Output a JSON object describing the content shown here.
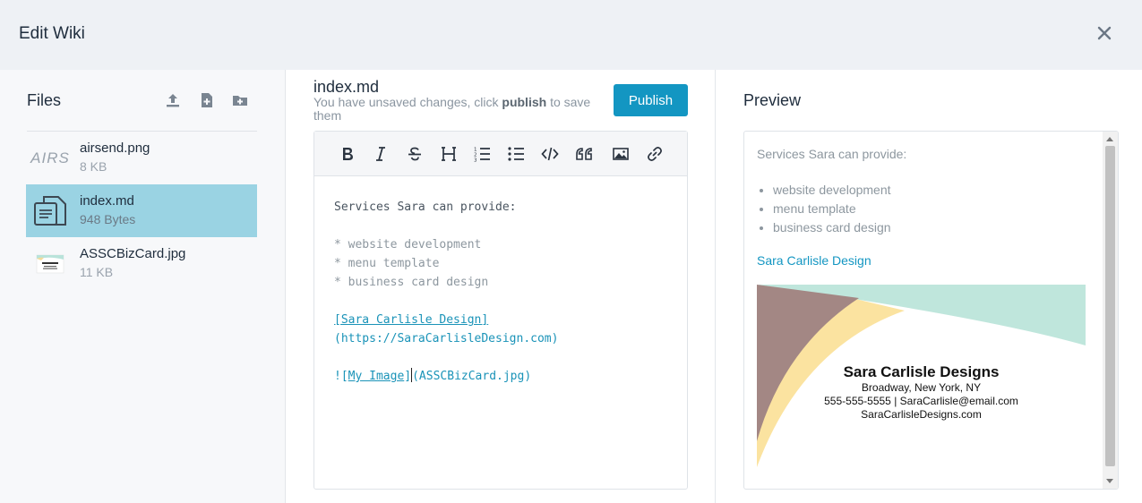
{
  "window": {
    "title": "Edit Wiki"
  },
  "files": {
    "heading": "Files",
    "items": [
      {
        "name": "airsend.png",
        "size": "8 KB",
        "thumb_text": "AIRS"
      },
      {
        "name": "index.md",
        "size": "948 Bytes",
        "active": true
      },
      {
        "name": "ASSCBizCard.jpg",
        "size": "11 KB"
      }
    ]
  },
  "editor": {
    "filename": "index.md",
    "notice_pre": "You have unsaved changes, click ",
    "notice_bold": "publish",
    "notice_post": " to save them",
    "publish_label": "Publish",
    "lines": {
      "l1": "Services Sara can provide:",
      "l2": "* website development",
      "l3": "* menu template",
      "l4": "* business card design",
      "l5_text": "[Sara Carlisle Design]",
      "l6": "(https://SaraCarlisleDesign.com)",
      "l7_prefix": "![",
      "l7_text": "My Image",
      "l7_close": "]",
      "l7_rest": "(ASSCBizCard.jpg)"
    }
  },
  "preview": {
    "heading": "Preview",
    "intro": "Services Sara can provide:",
    "list": [
      "website development",
      "menu template",
      "business card design"
    ],
    "link": "Sara Carlisle Design",
    "card": {
      "name": "Sara Carlisle Designs",
      "address": "Broadway, New York, NY",
      "contact": "555-555-5555 | SaraCarlisle@email.com",
      "site": "SaraCarlisleDesigns.com"
    }
  },
  "colors": {
    "accent": "#1396c2",
    "active_row": "#9ad3e3",
    "header_bg": "#eef1f5"
  }
}
